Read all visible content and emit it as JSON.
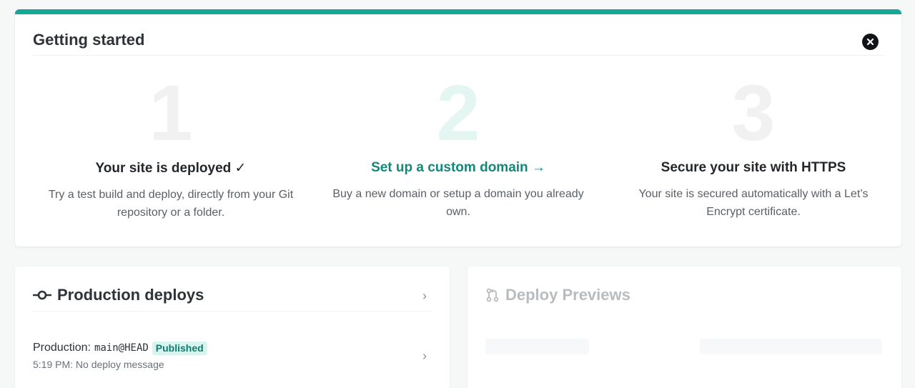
{
  "getting_started": {
    "title": "Getting started",
    "accent_color": "#15a898",
    "close_icon": "close-icon",
    "steps": [
      {
        "number": "1",
        "heading": "Your site is deployed ✓",
        "description": "Try a test build and deploy, directly from your Git repository or a folder.",
        "status": "done"
      },
      {
        "number": "2",
        "heading": "Set up a custom domain →",
        "description": "Buy a new domain or setup a domain you already own.",
        "status": "active"
      },
      {
        "number": "3",
        "heading": "Secure your site with HTTPS",
        "description": "Your site is secured automatically with a Let’s Encrypt certificate.",
        "status": "done"
      }
    ]
  },
  "production_deploys": {
    "icon": "commit-icon",
    "title": "Production deploys",
    "latest": {
      "label": "Production:",
      "branch": "main@HEAD",
      "status": "Published",
      "time": "5:19 PM:",
      "message": "No deploy message"
    }
  },
  "deploy_previews": {
    "icon": "pull-request-icon",
    "title": "Deploy Previews"
  }
}
